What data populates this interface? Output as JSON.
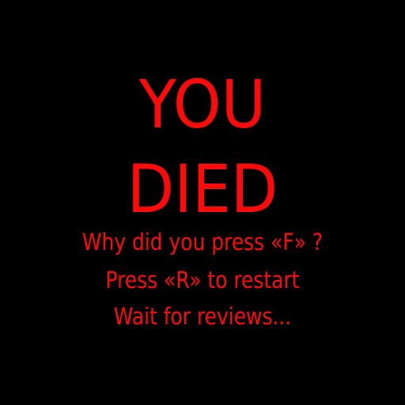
{
  "screen": {
    "title_line_1": "YOU",
    "title_line_2": "DIED",
    "messages": [
      "Why did you press «F» ?",
      "Press «R» to restart",
      "Wait for reviews..."
    ]
  },
  "colors": {
    "background": "#000000",
    "text": "#ff0a0a"
  }
}
